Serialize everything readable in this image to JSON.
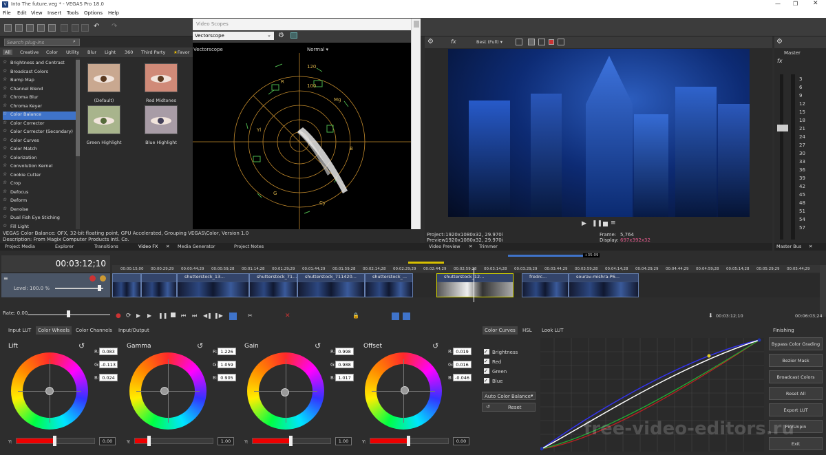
{
  "title": "Into The future.veg * - VEGAS Pro 18.0",
  "menu": [
    "File",
    "Edit",
    "View",
    "Insert",
    "Tools",
    "Options",
    "Help"
  ],
  "fx": {
    "search_placeholder": "Search plug-ins",
    "categories": [
      "All",
      "Creative",
      "Color",
      "Utility",
      "Blur",
      "Light",
      "360",
      "Third Party",
      "Favor"
    ],
    "plugins": [
      "Brightness and Contrast",
      "Broadcast Colors",
      "Bump Map",
      "Channel Blend",
      "Chroma Blur",
      "Chroma Keyer",
      "Color Balance",
      "Color Corrector",
      "Color Corrector (Secondary)",
      "Color Curves",
      "Color Match",
      "Colorization",
      "Convolution Kernel",
      "Cookie Cutter",
      "Crop",
      "Defocus",
      "Deform",
      "Denoise",
      "Dual Fish Eye Stiching",
      "Fill Light"
    ],
    "selected_plugin": "Color Balance",
    "presets": [
      "(Default)",
      "Red Midtones",
      "Green Highlight",
      "Blue Highlight"
    ],
    "description1": "VEGAS Color Balance: OFX, 32-bit floating point, GPU Accelerated, Grouping VEGAS\\Color, Version 1.0",
    "description2": "Description: From Magix Computer Products Intl. Co.",
    "tabs": [
      "Project Media",
      "Explorer",
      "Transitions",
      "Video FX",
      "Media Generator",
      "Project Notes"
    ]
  },
  "scopes": {
    "window_title": "Video Scopes",
    "selected": "Vectorscope",
    "label": "Vectorscope",
    "mode": "Normal",
    "marks": [
      "R",
      "Mg",
      "B",
      "Yl",
      "G",
      "Cy",
      "120",
      "100"
    ]
  },
  "preview": {
    "quality": "Best (Full)",
    "project_label": "Project:",
    "project_value": "1920x1080x32, 29.970i",
    "preview_label": "Preview:",
    "preview_value": "1920x1080x32, 29.970i",
    "frame_label": "Frame:",
    "frame_value": "5,764",
    "display_label": "Display:",
    "display_value": "697x392x32",
    "tabs": [
      "Video Preview",
      "Trimmer"
    ]
  },
  "master": {
    "label": "Master",
    "scale": [
      "3",
      "6",
      "9",
      "12",
      "15",
      "18",
      "21",
      "24",
      "27",
      "30",
      "33",
      "36",
      "39",
      "42",
      "45",
      "48",
      "51",
      "54",
      "57"
    ],
    "tab": "Master Bus"
  },
  "timeline": {
    "timecode": "00:03:12;10",
    "level": "Level: 100.0 %",
    "rate": "Rate: 0.00",
    "marker": "+35:09",
    "ruler": [
      "00:00:15;00",
      "00:00:29;29",
      "00:00:44;29",
      "00:00:59;28",
      "00:01:14;28",
      "00:01:29;29",
      "00:01:44;29",
      "00:01:59;28",
      "00:02:14;28",
      "00:02:29;29",
      "00:02:44;29",
      "00:02:59;28",
      "00:03:14;28",
      "00:03:29;29",
      "00:03:44;29",
      "00:03:59;28",
      "00:04:14;28",
      "00:04:29;29",
      "00:04:44;29",
      "00:04:59;28",
      "00:05:14;28",
      "00:05:29;29",
      "00:05:44;29"
    ],
    "clips": [
      "shutterstock_13...",
      "shutterstock_71...",
      "shutterstock_711420...",
      "shutterstock_...",
      "shutterstock_12...",
      "fredrc...",
      "sourav-mishra-P6..."
    ],
    "cursor_time": "00:03:12;10",
    "end_time": "00:06:03;24"
  },
  "grading": {
    "tabs": [
      "Input LUT",
      "Color Wheels",
      "Color Channels",
      "Input/Output"
    ],
    "wheels": [
      {
        "name": "Lift",
        "r": "0.083",
        "g": "-0.113",
        "b": "0.024",
        "y": "0.00"
      },
      {
        "name": "Gamma",
        "r": "1.226",
        "g": "1.059",
        "b": "0.905",
        "y": "1.00"
      },
      {
        "name": "Gain",
        "r": "0.998",
        "g": "0.988",
        "b": "1.017",
        "y": "1.00"
      },
      {
        "name": "Offset",
        "r": "0.019",
        "g": "0.016",
        "b": "-0.046",
        "y": "0.00"
      }
    ],
    "r_label": "R:",
    "g_label": "G:",
    "b_label": "B:",
    "y_label": "Y:",
    "curve_tabs": [
      "Color Curves",
      "HSL",
      "Look LUT"
    ],
    "channels": [
      "Brightness",
      "Red",
      "Green",
      "Blue"
    ],
    "auto_balance": "Auto Color Balance",
    "reset": "Reset",
    "finishing_tab": "Finishing",
    "finishing": [
      "Bypass Color Grading",
      "Bezier Mask",
      "Broadcast Colors",
      "Reset All",
      "Export LUT",
      "Pin/Unpin",
      "Exit"
    ]
  },
  "watermark": "free-video-editors.ru",
  "colors": {
    "accent": "#3f73c9",
    "selected_row": "#3f73c9",
    "wheel_slider": "#e00000"
  }
}
